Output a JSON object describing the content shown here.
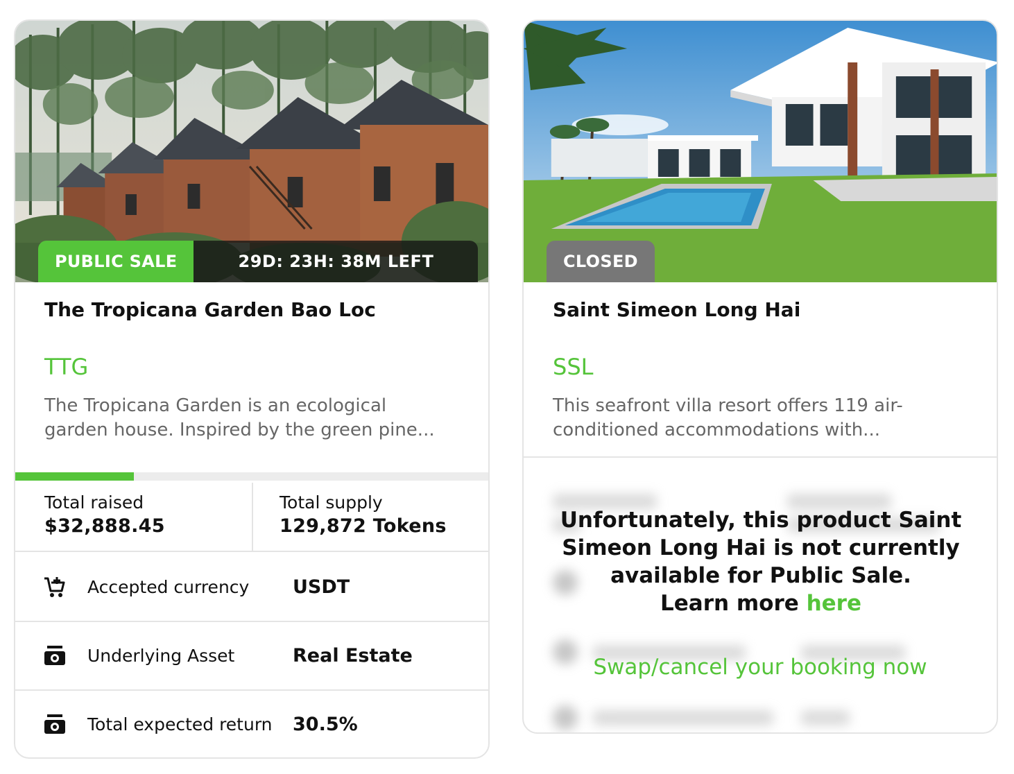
{
  "colors": {
    "accent": "#55c43a",
    "closed_badge": "#777777",
    "muted_text": "#666666"
  },
  "cards": [
    {
      "status_badge": "PUBLIC SALE",
      "countdown": "29D: 23H: 38M LEFT",
      "title": "The Tropicana Garden Bao Loc",
      "ticker": "TTG",
      "description_line1": "The Tropicana Garden is an ecological",
      "description_line2": "garden house. Inspired by the green pine...",
      "progress": 0.25,
      "stats": {
        "total_raised_label": "Total raised",
        "total_raised_value": "$32,888.45",
        "total_supply_label": "Total supply",
        "total_supply_value": "129,872 Tokens"
      },
      "details": [
        {
          "icon": "cart-icon",
          "label": "Accepted currency",
          "value": "USDT"
        },
        {
          "icon": "asset-icon",
          "label": "Underlying Asset",
          "value": "Real Estate"
        },
        {
          "icon": "return-icon",
          "label": "Total expected return",
          "value": "30.5%"
        }
      ]
    },
    {
      "status_badge": "CLOSED",
      "title": "Saint Simeon Long Hai",
      "ticker": "SSL",
      "description_line1": "This seafront villa resort offers 119 air-",
      "description_line2": "conditioned accommodations with...",
      "notice_line1": "Unfortunately, this product Saint",
      "notice_line2": "Simeon Long Hai is not currently",
      "notice_line3": "available for Public Sale.",
      "notice_learn": "Learn more ",
      "notice_link": "here",
      "swap_link": "Swap/cancel your booking now"
    }
  ]
}
